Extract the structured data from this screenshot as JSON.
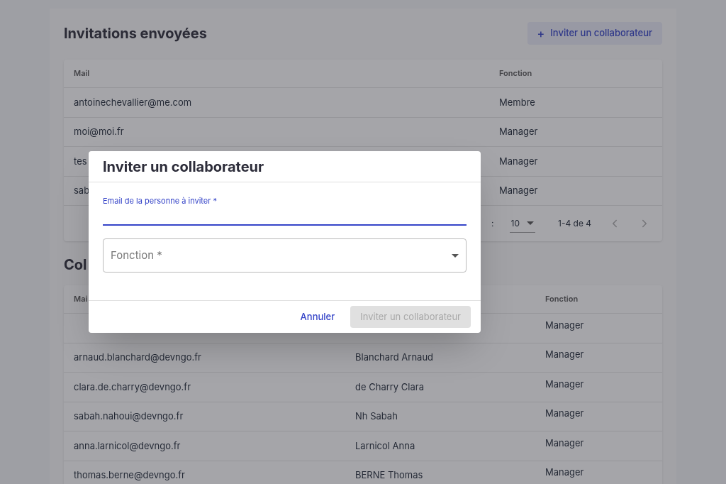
{
  "invitations": {
    "title": "Invitations envoyées",
    "invite_button": {
      "icon": "+",
      "label": "Inviter un collaborateur"
    },
    "columns": [
      "Mail",
      "Fonction"
    ],
    "rows": [
      {
        "mail": "antoinechevallier@me.com",
        "fonction": "Membre"
      },
      {
        "mail": "moi@moi.fr",
        "fonction": "Manager"
      },
      {
        "mail": "tes",
        "fonction": "Manager"
      },
      {
        "mail": "sab",
        "fonction": "Manager"
      }
    ],
    "pagination": {
      "rows_per_page_label": ":",
      "rows_per_page": "10",
      "range": "1-4 de 4"
    }
  },
  "collaborators": {
    "title": "Col",
    "columns": [
      "Mai",
      "Fonction"
    ],
    "rows": [
      {
        "fonction": "Manager"
      },
      {
        "mail": "arnaud.blanchard@devngo.fr",
        "name": "Blanchard Arnaud",
        "fonction": "Manager"
      },
      {
        "mail": "clara.de.charry@devngo.fr",
        "name": "de Charry Clara",
        "fonction": "Manager"
      },
      {
        "mail": "sabah.nahoui@devngo.fr",
        "name": "Nh Sabah",
        "fonction": "Manager"
      },
      {
        "mail": "anna.larnicol@devngo.fr",
        "name": "Larnicol Anna",
        "fonction": "Manager"
      },
      {
        "mail": "thomas.berne@devngo.fr",
        "name": "BERNE Thomas",
        "fonction": "Manager"
      }
    ]
  },
  "dialog": {
    "title": "Inviter un collaborateur",
    "email_field": {
      "label": "Email de la personne à inviter *",
      "focused": true
    },
    "fonction_field": {
      "placeholder": "Fonction *"
    },
    "cancel": "Annuler",
    "submit": {
      "label": "Inviter un collaborateur",
      "disabled": true
    }
  }
}
